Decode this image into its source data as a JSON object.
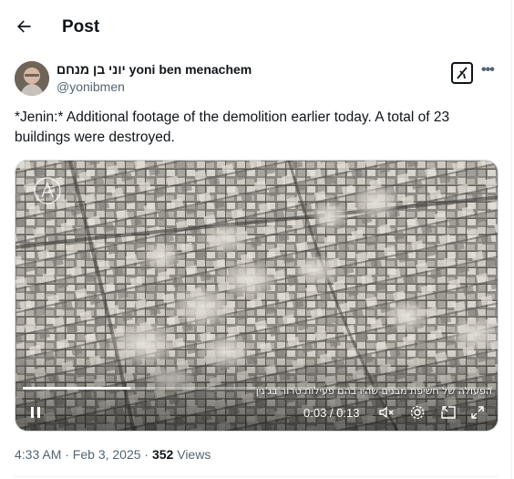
{
  "header": {
    "title": "Post",
    "back_icon": "arrow-left-icon"
  },
  "author": {
    "display_name": "יוני בן מנחם yoni ben menachem",
    "handle": "@yonibmen"
  },
  "tweet": {
    "text": "*Jenin:* Additional footage of the demolition earlier today. A total of 23 buildings were destroyed."
  },
  "video": {
    "caption": "הפעולה של חשיפת מבנים שהיו בהם פעילות טרור בג'נין",
    "timecode": "0:03 / 0:13",
    "progress": 0.23
  },
  "meta": {
    "time_date": "4:33 AM · Feb 3, 2025 · ",
    "views_count": "352",
    "views_label": " Views"
  },
  "colors": {
    "text": "#0f1419",
    "secondary": "#536471",
    "border": "#cfd9de"
  }
}
